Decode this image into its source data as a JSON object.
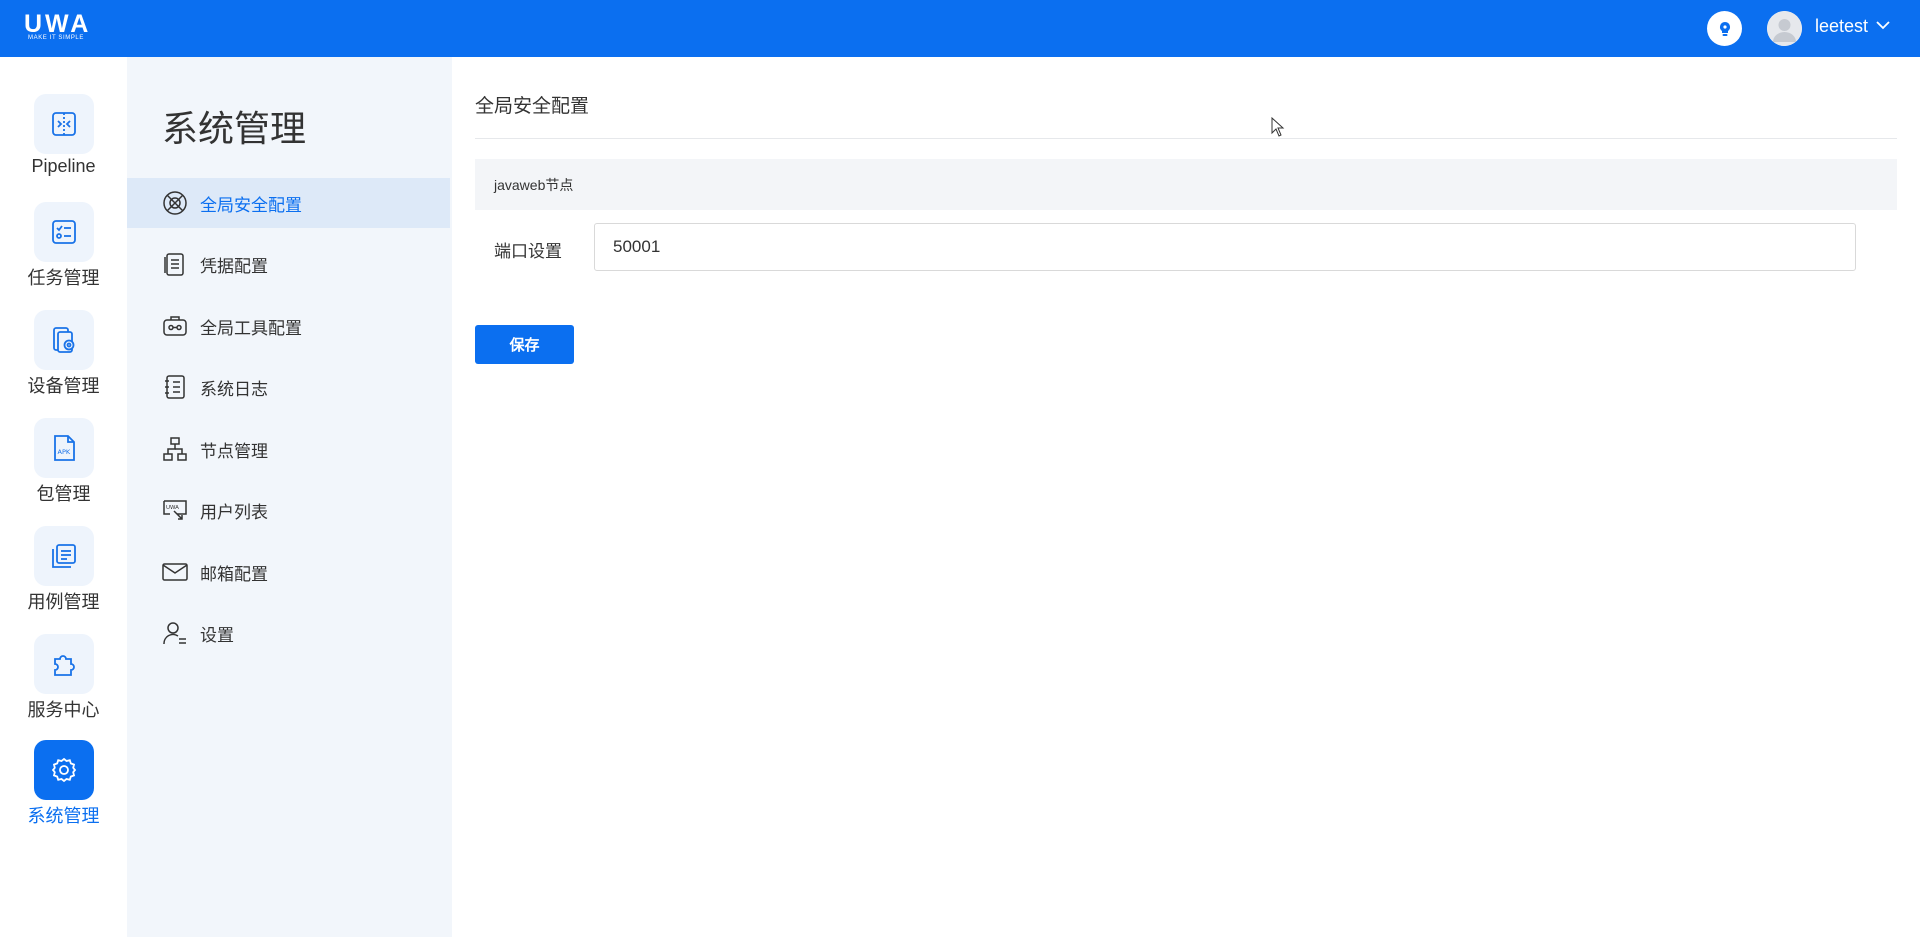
{
  "header": {
    "logo_text": "UWA",
    "logo_tagline": "MAKE IT SIMPLE",
    "username": "leetest",
    "bg_color": "#0b6ff0"
  },
  "rail": {
    "items": [
      {
        "label": "Pipeline",
        "icon": "pipeline-icon"
      },
      {
        "label": "任务管理",
        "icon": "task-checklist-icon"
      },
      {
        "label": "设备管理",
        "icon": "device-settings-icon"
      },
      {
        "label": "包管理",
        "icon": "apk-file-icon"
      },
      {
        "label": "用例管理",
        "icon": "case-list-icon"
      },
      {
        "label": "服务中心",
        "icon": "puzzle-icon"
      },
      {
        "label": "系统管理",
        "icon": "gear-icon",
        "active": true
      }
    ]
  },
  "subnav": {
    "title": "系统管理",
    "items": [
      {
        "label": "全局安全配置",
        "icon": "security-globe-icon",
        "active": true
      },
      {
        "label": "凭据配置",
        "icon": "credential-doc-icon"
      },
      {
        "label": "全局工具配置",
        "icon": "toolbox-icon"
      },
      {
        "label": "系统日志",
        "icon": "log-book-icon"
      },
      {
        "label": "节点管理",
        "icon": "node-tree-icon"
      },
      {
        "label": "用户列表",
        "icon": "user-list-icon"
      },
      {
        "label": "邮箱配置",
        "icon": "mail-icon"
      },
      {
        "label": "设置",
        "icon": "user-settings-icon"
      }
    ]
  },
  "main": {
    "title": "全局安全配置",
    "section_label": "javaweb节点",
    "port_label": "端口设置",
    "port_value": "50001",
    "save_label": "保存"
  }
}
